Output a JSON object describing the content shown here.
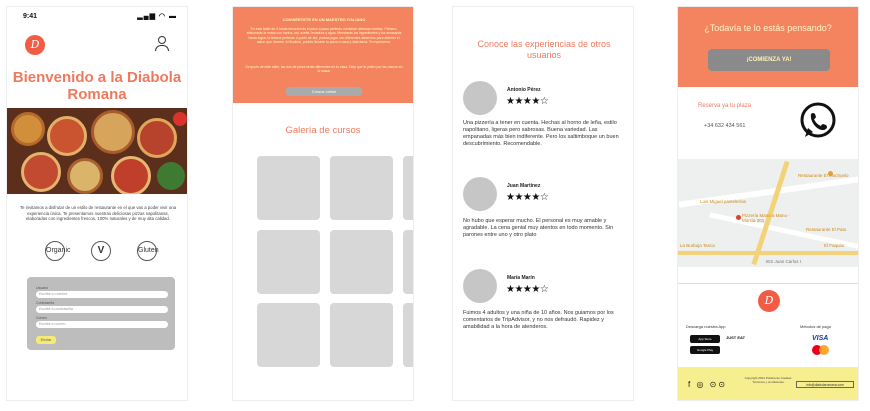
{
  "screen1": {
    "status_time": "9:41",
    "status_icons": "▂▄▆ ◠ ▬",
    "logo_letter": "D",
    "welcome": "Bienvenido a la Diabola Romana",
    "intro": "Te invitamos a disfrutar de un estilo de restaurante en el que vas a poder vivir una experiencia única. Te presentamos nuestras deliciosas pizzas napolitanas, elaboradas con ingredientes frescos, 100% naturales y de muy alta calidad.",
    "badges": [
      "Organic",
      "V",
      "Gluten"
    ],
    "form": {
      "f1_label": "Usuario",
      "f1_placeholder": "Escribe tu nombre",
      "f2_label": "Contraseña",
      "f2_placeholder": "Escribe tu contraseña",
      "f3_label": "Correo",
      "f3_placeholder": "Escribe tu correo",
      "submit": "Enviar"
    },
    "colors": {
      "accent": "#ee7a5e",
      "logo_bg": "#f25c45"
    }
  },
  "screen2": {
    "promo_title": "CONVIÉRTETE EN UN MAESTRO ITALIANO",
    "promo_body": "En este taller de 3 horas descubrirás el paso a paso perfecto mediante diversas recetas. Primero, elaborarás la masa con harina, sal, aceite, levadura y agua. Mezclarás los ingredientes y los amasarás hasta lograr la textura perfecta. A partir de ahí, podrás jugar con diferentes alimentos para obtener el sabor que desees. Al finalizar, podrás llevarte tu pizza a casa y disfrutarla. Te esperamos.",
    "promo_body2": "Después de este taller, las dos de pizza serán diferentes en tu casa. Deja que te piden por las manos en la masa.",
    "promo_button": "Cursos online",
    "gallery_title": "Galería de cursos",
    "colors": {
      "promo_bg": "#f3845f",
      "tile": "#d7d7d7"
    }
  },
  "screen3": {
    "title": "Conoce las experiencias de otros usuarios",
    "reviews": [
      {
        "name": "Antonio Pérez",
        "stars": "★★★★☆",
        "text": "Una pizzería a tener en cuenta. Hechas al horno de leña, estilo napolitano, ligeras pero sabrosas. Buena variedad. Las empanadas más bien indiferente. Pero los saltimboque un buen descubrimiento. Recomendable."
      },
      {
        "name": "Juan Martínez",
        "stars": "★★★★☆",
        "text": "No hubo que esperar mucho. El personal es muy amable y agradable. La cena genial muy atentos en todo momento. Sin parones entre uno y otro plato"
      },
      {
        "name": "María Marín",
        "stars": "★★★★☆",
        "text": "Fuimos 4 adultos y una niña de 10 años. Nos guiamos por los comentarios de TripAdvisor, y no nos defraudó. Rapidez y amabilidad a la hora de atenderos."
      }
    ]
  },
  "screen4": {
    "question": "¿Todavía te lo estás pensando?",
    "cta_button": "¡COMIENZA YA!",
    "reserve_label": "Reserva ya tu plaza",
    "phone": "+34 632 434 561",
    "map_labels": [
      "Restaurante El Mochuelo",
      "Luis Miguel pastelerías",
      "Pizzería Mano a Mano - Murcia 201",
      "Restaurante El Pato",
      "La Burbuja Tasca",
      "El Faquito",
      "IES Juan Carlos I"
    ],
    "logo_letter": "D",
    "download_label": "Descarga nuestra App",
    "payment_label": "Métodos de pago",
    "app_store": "App Store",
    "google_play": "Google Play",
    "just_eat": "JUST EAT",
    "visa": "VISA",
    "social": "f ◎ ⊙⊙",
    "copyright": "Copyright 2021 Política de Cookies Términos y condiciones",
    "email": "info@diabolaromana.com"
  }
}
